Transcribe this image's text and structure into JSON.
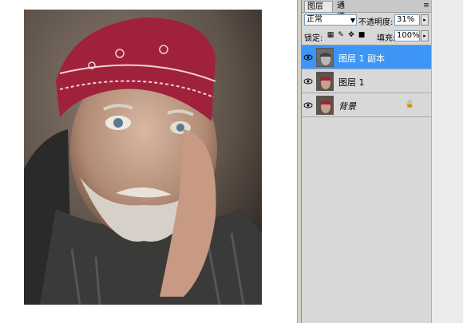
{
  "layers_panel": {
    "tabs": [
      {
        "label": "图层"
      },
      {
        "label": "通道"
      }
    ],
    "tab_close": "×",
    "panel_menu": "≡",
    "blend_mode": "正常",
    "blend_arrow": "▼",
    "opacity_label": "不透明度:",
    "opacity_value": "31%",
    "spin_arrow": "▸",
    "lock_label": "锁定:",
    "fill_label": "填充:",
    "fill_value": "100%",
    "lock_icons": [
      "transparency-lock-icon",
      "brush-lock-icon",
      "move-lock-icon",
      "padlock-icon"
    ],
    "layers": [
      {
        "name": "图层 1 副本",
        "selected": true
      },
      {
        "name": "图层 1",
        "selected": false
      },
      {
        "name": "背景",
        "selected": false,
        "locked": true
      }
    ],
    "colors": {
      "selected": "#3d96f5",
      "panel": "#d8d8d8"
    }
  }
}
